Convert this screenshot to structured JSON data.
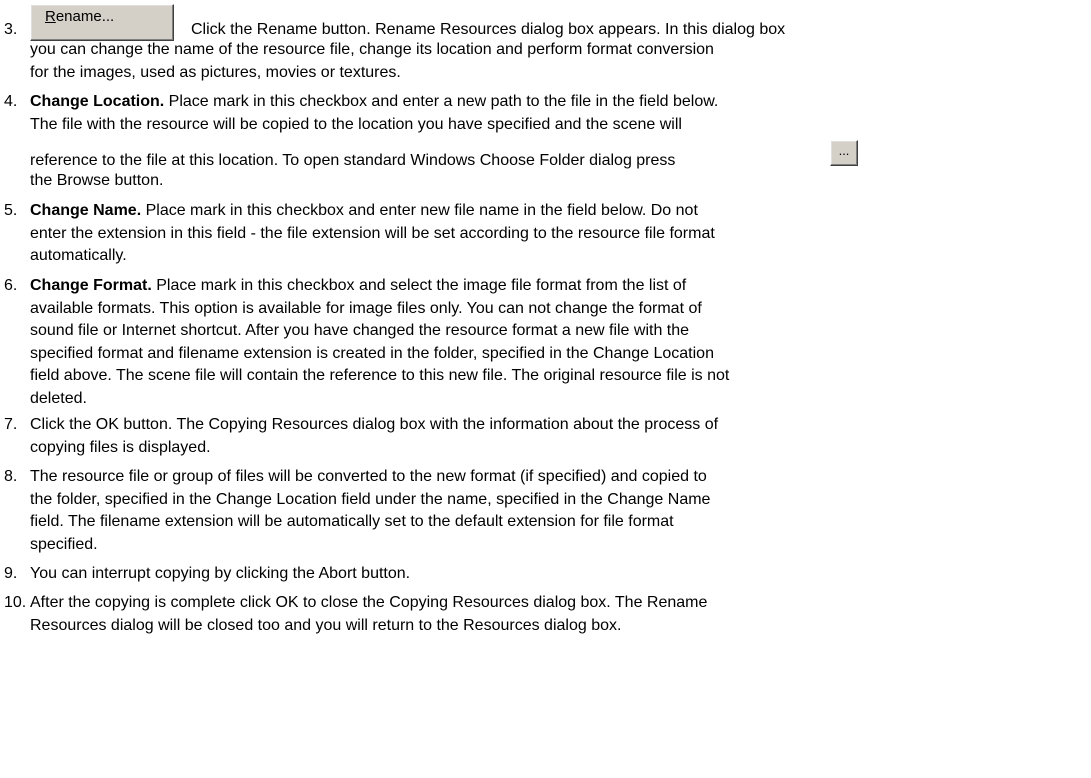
{
  "step3": {
    "num": "3.",
    "button_underlined": "R",
    "button_rest": "ename...",
    "line1": "Click the Rename button. Rename Resources dialog box appears. In this dialog box",
    "line2": "you can change the name of the resource file, change its location and perform format conversion",
    "line3": "for the images, used as pictures, movies or textures."
  },
  "step4": {
    "num": "4.",
    "bold": "Change Location.",
    "line1": " Place mark in this checkbox and enter a new path to the file in the field below.",
    "line2": "The file with the resource will be copied to the location you have specified and the scene will",
    "line3": "reference to the file at this location. To open standard Windows Choose Folder dialog press",
    "browse_label": "...",
    "line4": "the Browse button."
  },
  "step5": {
    "num": "5.",
    "bold": "Change Name.",
    "line1": " Place mark in this checkbox and enter new file name in the field below. Do not",
    "line2": "enter the extension in this field - the file extension will be set according to the resource file format",
    "line3": "automatically."
  },
  "step6": {
    "num": "6.",
    "bold": "Change Format.",
    "line1": " Place mark in this checkbox and select the image file format from the list of",
    "line2": "available formats. This option is available for image files only. You can not change the format of",
    "line3": "sound file or Internet shortcut. After you have changed the resource format a new file with the",
    "line4": "specified format and filename extension is created in the folder, specified in the Change Location",
    "line5": "field above. The scene file will contain the reference to this new file. The original resource file is not",
    "line6": "deleted."
  },
  "step7": {
    "num": "7.",
    "line1": "Click the OK button. The Copying Resources dialog box with the information about the process of",
    "line2": "copying files is displayed."
  },
  "step8": {
    "num": "8.",
    "line1": "The resource file or group of files will be converted to the new format (if specified) and copied to",
    "line2": "the folder, specified in the Change Location field under the name, specified in the Change Name",
    "line3": "field. The filename extension will be automatically set to the default extension for file format",
    "line4": "specified."
  },
  "step9": {
    "num": "9.",
    "line1": "You can interrupt copying by clicking the Abort button."
  },
  "step10": {
    "num": "10.",
    "line1": "After the copying is complete click OK to close the Copying Resources dialog box. The Rename",
    "line2": "Resources dialog will be closed too and you will return to the Resources dialog box."
  }
}
